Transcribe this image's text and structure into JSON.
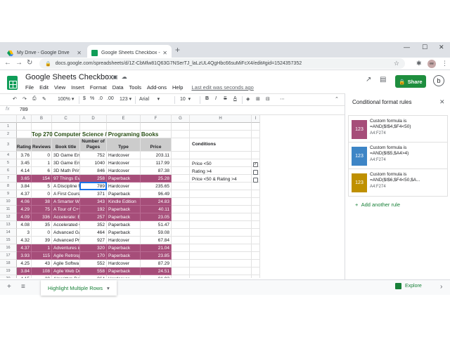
{
  "browser": {
    "tabs": [
      {
        "label": "My Drive - Google Drive",
        "active": false
      },
      {
        "label": "Google Sheets Checkbox - Goog",
        "active": true
      }
    ],
    "url": "docs.google.com/spreadsheets/d/1Z-CbMlw81Q63G7NSerTJ_laLzUL4QgHbc66suMiFcX4/edit#gid=1524357352",
    "profile_initials": "ee"
  },
  "doc": {
    "title": "Google Sheets Checkbox",
    "menu": [
      "File",
      "Edit",
      "View",
      "Insert",
      "Format",
      "Data",
      "Tools",
      "Add-ons",
      "Help"
    ],
    "last_edit": "Last edit was seconds ago",
    "share_label": "Share",
    "user_initial": "b"
  },
  "toolbar": {
    "zoom": "100%",
    "currency": "$",
    "percent": "%",
    "decimal_dec": ".0",
    "decimal_inc": ".00",
    "more_formats": "123",
    "font": "Arial",
    "font_size": "10",
    "bold": "B",
    "italic": "I",
    "strike": "S",
    "text_color": "A"
  },
  "formula_bar": {
    "fx": "fx",
    "value": "789"
  },
  "grid": {
    "columns": [
      "A",
      "B",
      "C",
      "D",
      "E",
      "F",
      "G",
      "H",
      "I"
    ],
    "row_numbers": [
      "1",
      "2",
      "3",
      "4",
      "5",
      "6",
      "7",
      "8",
      "9",
      "10",
      "11",
      "12",
      "13",
      "14",
      "15",
      "16",
      "17",
      "18",
      "19",
      "20"
    ],
    "title": "Top 270 Computer Science / Programing Books",
    "headers": [
      "Rating",
      "Reviews",
      "Book title",
      "Number of Pages",
      "Type",
      "Price"
    ],
    "rows": [
      {
        "rating": "3.76",
        "reviews": "0",
        "title": "3D Game En",
        "pages": "752",
        "type": "Hardcover",
        "price": "203.11",
        "hl": false
      },
      {
        "rating": "3.45",
        "reviews": "1",
        "title": "3D Game En",
        "pages": "1040",
        "type": "Hardcover",
        "price": "117.99",
        "hl": false
      },
      {
        "rating": "4.14",
        "reviews": "6",
        "title": "3D Math Prin",
        "pages": "846",
        "type": "Hardcover",
        "price": "87.38",
        "hl": false
      },
      {
        "rating": "3.65",
        "reviews": "154",
        "title": "97 Things Ev",
        "pages": "258",
        "type": "Paperback",
        "price": "25.28",
        "hl": true
      },
      {
        "rating": "3.84",
        "reviews": "5",
        "title": "A Discipline f",
        "pages": "789",
        "type": "Hardcover",
        "price": "235.65",
        "hl": false
      },
      {
        "rating": "4.37",
        "reviews": "0",
        "title": "A First Cours",
        "pages": "371",
        "type": "Paperback",
        "price": "96.49",
        "hl": false
      },
      {
        "rating": "4.06",
        "reviews": "38",
        "title": "A Smarter Wa",
        "pages": "343",
        "type": "Kindle Edition",
        "price": "24.83",
        "hl": true
      },
      {
        "rating": "4.29",
        "reviews": "75",
        "title": "A Tour of C++",
        "pages": "192",
        "type": "Paperback",
        "price": "40.11",
        "hl": true
      },
      {
        "rating": "4.09",
        "reviews": "336",
        "title": "Accelerate: B",
        "pages": "257",
        "type": "Paperback",
        "price": "23.05",
        "hl": true
      },
      {
        "rating": "4.08",
        "reviews": "35",
        "title": "Accelerated C",
        "pages": "352",
        "type": "Paperback",
        "price": "51.47",
        "hl": false
      },
      {
        "rating": "3",
        "reviews": "0",
        "title": "Advanced Ga",
        "pages": "464",
        "type": "Paperback",
        "price": "59.08",
        "hl": false
      },
      {
        "rating": "4.32",
        "reviews": "39",
        "title": "Advanced Pro",
        "pages": "927",
        "type": "Hardcover",
        "price": "67.84",
        "hl": false
      },
      {
        "rating": "4.37",
        "reviews": "1",
        "title": "Adventures in",
        "pages": "320",
        "type": "Paperback",
        "price": "21.04",
        "hl": true
      },
      {
        "rating": "3.93",
        "reviews": "115",
        "title": "Agile Retrosp",
        "pages": "170",
        "type": "Paperback",
        "price": "23.85",
        "hl": true
      },
      {
        "rating": "4.25",
        "reviews": "43",
        "title": "Agile Softwa",
        "pages": "552",
        "type": "Hardcover",
        "price": "87.29",
        "hl": false
      },
      {
        "rating": "3.84",
        "reviews": "108",
        "title": "Agile Web De",
        "pages": "558",
        "type": "Paperback",
        "price": "24.51",
        "hl": true
      },
      {
        "rating": "4.15",
        "reviews": "20",
        "title": "Algorithm De",
        "pages": "864",
        "type": "Hardcover",
        "price": "81.92",
        "hl": false
      }
    ],
    "conditions": {
      "heading": "Conditions",
      "items": [
        {
          "label": "Price <50",
          "checked": true
        },
        {
          "label": "Rating >4",
          "checked": false
        },
        {
          "label": "Price <50 & Rating >4",
          "checked": false
        }
      ]
    },
    "highlight_color": "#a64d79"
  },
  "sheet_bar": {
    "active_sheet": "Highlight Multiple Rows",
    "explore_label": "Explore"
  },
  "panel": {
    "title": "Conditional format rules",
    "rules": [
      {
        "swatch_label": "123",
        "color": "#a64d79",
        "line1": "Custom formula is",
        "line2": "=AND($I$4,$F4<50)",
        "range": "A4:F274"
      },
      {
        "swatch_label": "123",
        "color": "#3d85c6",
        "line1": "Custom formula is",
        "line2": "=AND($I$5,$A4>4)",
        "range": "A4:F274"
      },
      {
        "swatch_label": "123",
        "color": "#bf9000",
        "line1": "Custom formula is",
        "line2": "=AND($I$6,$F4<50,$A...",
        "range": "A4:F274"
      }
    ],
    "add_label": "Add another rule"
  }
}
